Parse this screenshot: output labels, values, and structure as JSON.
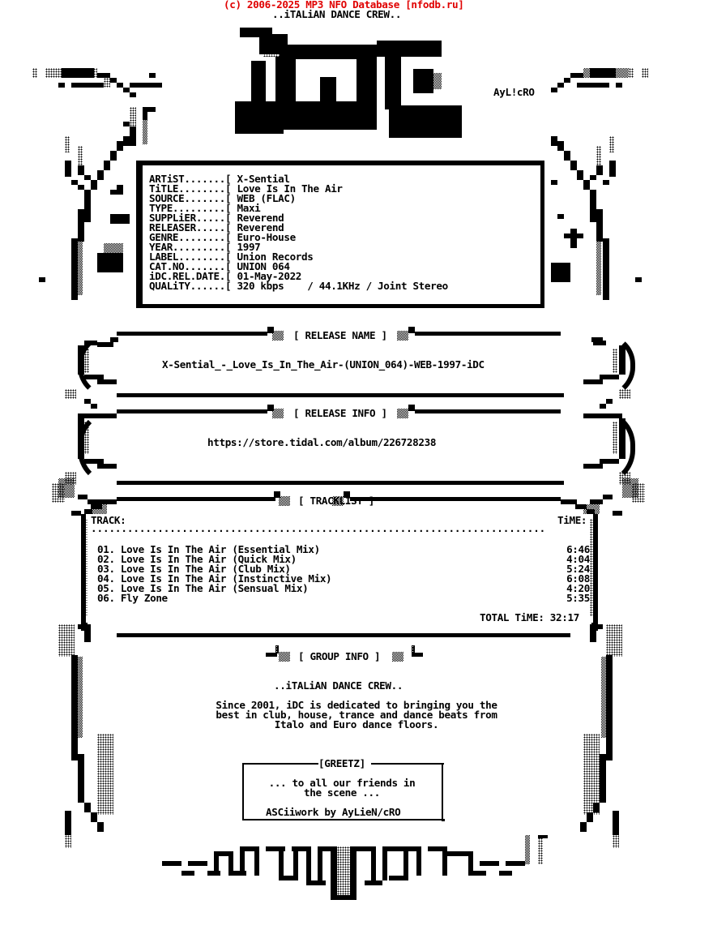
{
  "header": {
    "copyright": "(c) 2006-2025 MP3 NFO Database [nfodb.ru]",
    "group_tagline": "..iTALiAN DANCE CREW..",
    "logo_text": "iDC",
    "art_credit_tag": "AyL!cRO"
  },
  "release_details": {
    "fields": [
      {
        "label": "ARTiST.......[",
        "value": "X-Sential"
      },
      {
        "label": "TiTLE........[",
        "value": "Love Is In The Air"
      },
      {
        "label": "SOURCE.......[",
        "value": "WEB (FLAC)"
      },
      {
        "label": "TYPE.........[",
        "value": "Maxi"
      },
      {
        "label": "SUPPLiER.....[",
        "value": "Reverend"
      },
      {
        "label": "RELEASER.....[",
        "value": "Reverend"
      },
      {
        "label": "GENRE........[",
        "value": "Euro-House"
      },
      {
        "label": "YEAR.........[",
        "value": "1997"
      },
      {
        "label": "LABEL........[",
        "value": "Union Records"
      },
      {
        "label": "CAT.NO.......[",
        "value": "UNION 064"
      },
      {
        "label": "iDC.REL.DATE.[",
        "value": "01-May-2022"
      },
      {
        "label": "QUALiTY......[",
        "value": "320 kbps    / 44.1KHz / Joint Stereo"
      }
    ]
  },
  "release_name": {
    "heading": "[ RELEASE NAME ]",
    "value": "X-Sential_-_Love_Is_In_The_Air-(UNION_064)-WEB-1997-iDC"
  },
  "release_info": {
    "heading": "[ RELEASE INFO ]",
    "url": "https://store.tidal.com/album/226728238"
  },
  "tracklist": {
    "heading": "[ TRACKLIST ]",
    "col_track": "TRACK:",
    "col_time": "TiME:",
    "separator": "...........................................................................",
    "tracks": [
      {
        "title": "01. Love Is In The Air (Essential Mix)",
        "time": "6:46"
      },
      {
        "title": "02. Love Is In The Air (Quick Mix)",
        "time": "4:04"
      },
      {
        "title": "03. Love Is In The Air (Club Mix)",
        "time": "5:24"
      },
      {
        "title": "04. Love Is In The Air (Instinctive Mix)",
        "time": "6:08"
      },
      {
        "title": "05. Love Is In The Air (Sensual Mix)",
        "time": "4:20"
      },
      {
        "title": "06. Fly Zone",
        "time": "5:35"
      }
    ],
    "total": "TOTAL TiME: 32:17"
  },
  "group_info": {
    "heading": "[ GROUP INFO ]",
    "tagline": "..iTALiAN DANCE CREW..",
    "description": [
      "Since 2001, iDC is dedicated to bringing you the",
      "best in club, house, trance and dance beats from",
      "Italo and Euro dance floors."
    ]
  },
  "greetz": {
    "heading": "[GREETZ]",
    "lines": [
      "... to all our friends in",
      "the scene ..."
    ],
    "credit": "ASCiiwork by AyLieN/cRO"
  },
  "colors": {
    "copyright_red": "#e00000",
    "ink": "#000000",
    "paper": "#ffffff"
  }
}
